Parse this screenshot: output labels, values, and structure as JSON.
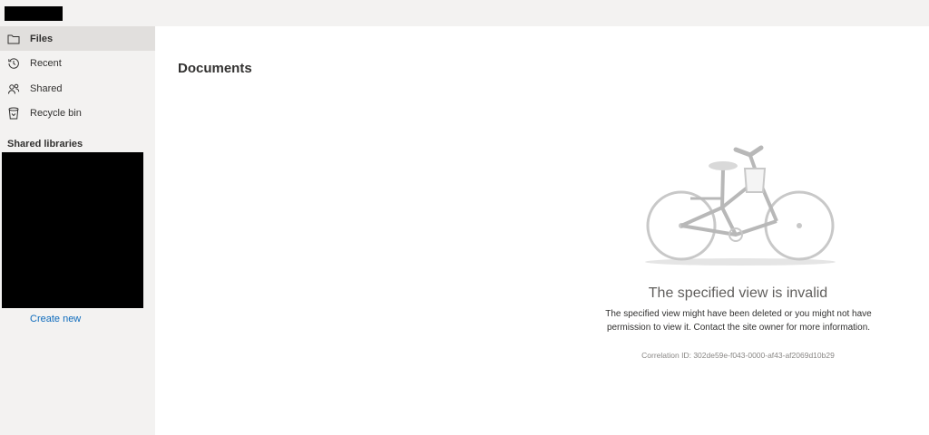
{
  "sidebar": {
    "items": [
      {
        "label": "Files",
        "icon": "folder-icon"
      },
      {
        "label": "Recent",
        "icon": "history-icon"
      },
      {
        "label": "Shared",
        "icon": "people-icon"
      },
      {
        "label": "Recycle bin",
        "icon": "trash-icon"
      }
    ],
    "section_title": "Shared libraries",
    "create_new": "Create new"
  },
  "main": {
    "title": "Documents",
    "empty": {
      "title": "The specified view is invalid",
      "message": "The specified view might have been deleted or you might not have permission to view it. Contact the site owner for more information.",
      "correlation": "Correlation ID: 302de59e-f043-0000-af43-af2069d10b29"
    }
  }
}
